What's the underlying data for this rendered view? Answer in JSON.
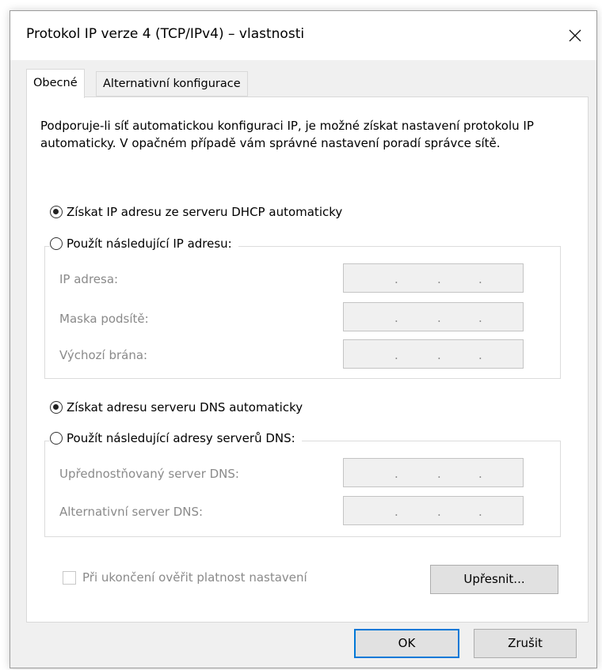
{
  "window": {
    "title": "Protokol IP verze 4 (TCP/IPv4) – vlastnosti",
    "close_glyph": "✕"
  },
  "tabs": [
    {
      "label": "Obecné",
      "active": true
    },
    {
      "label": "Alternativní konfigurace",
      "active": false
    }
  ],
  "intro_text": "Podporuje-li síť automatickou konfiguraci IP, je možné získat nastavení protokolu IP automaticky. V opačném případě vám správné nastavení poradí správce sítě.",
  "ip_section": {
    "auto_label": "Získat IP adresu ze serveru DHCP automaticky",
    "auto_selected": true,
    "manual_label": "Použít následující IP adresu:",
    "fields": [
      {
        "label": "IP adresa:",
        "value": ". . ."
      },
      {
        "label": "Maska podsítě:",
        "value": ". . ."
      },
      {
        "label": "Výchozí brána:",
        "value": ". . ."
      }
    ]
  },
  "dns_section": {
    "auto_label": "Získat adresu serveru DNS automaticky",
    "auto_selected": true,
    "manual_label": "Použít následující adresy serverů DNS:",
    "fields": [
      {
        "label": "Upřednostňovaný server DNS:",
        "value": ". . ."
      },
      {
        "label": "Alternativní server DNS:",
        "value": ". . ."
      }
    ]
  },
  "validate_checkbox": {
    "label": "Při ukončení ověřit platnost nastavení",
    "checked": false,
    "enabled": false
  },
  "buttons": {
    "advanced": "Upřesnit...",
    "ok": "OK",
    "cancel": "Zrušit"
  },
  "colors": {
    "window_bg": "#f0f0f0",
    "panel_bg": "#ffffff",
    "disabled_text": "#8a8a8a",
    "default_button_border": "#0078d7"
  }
}
